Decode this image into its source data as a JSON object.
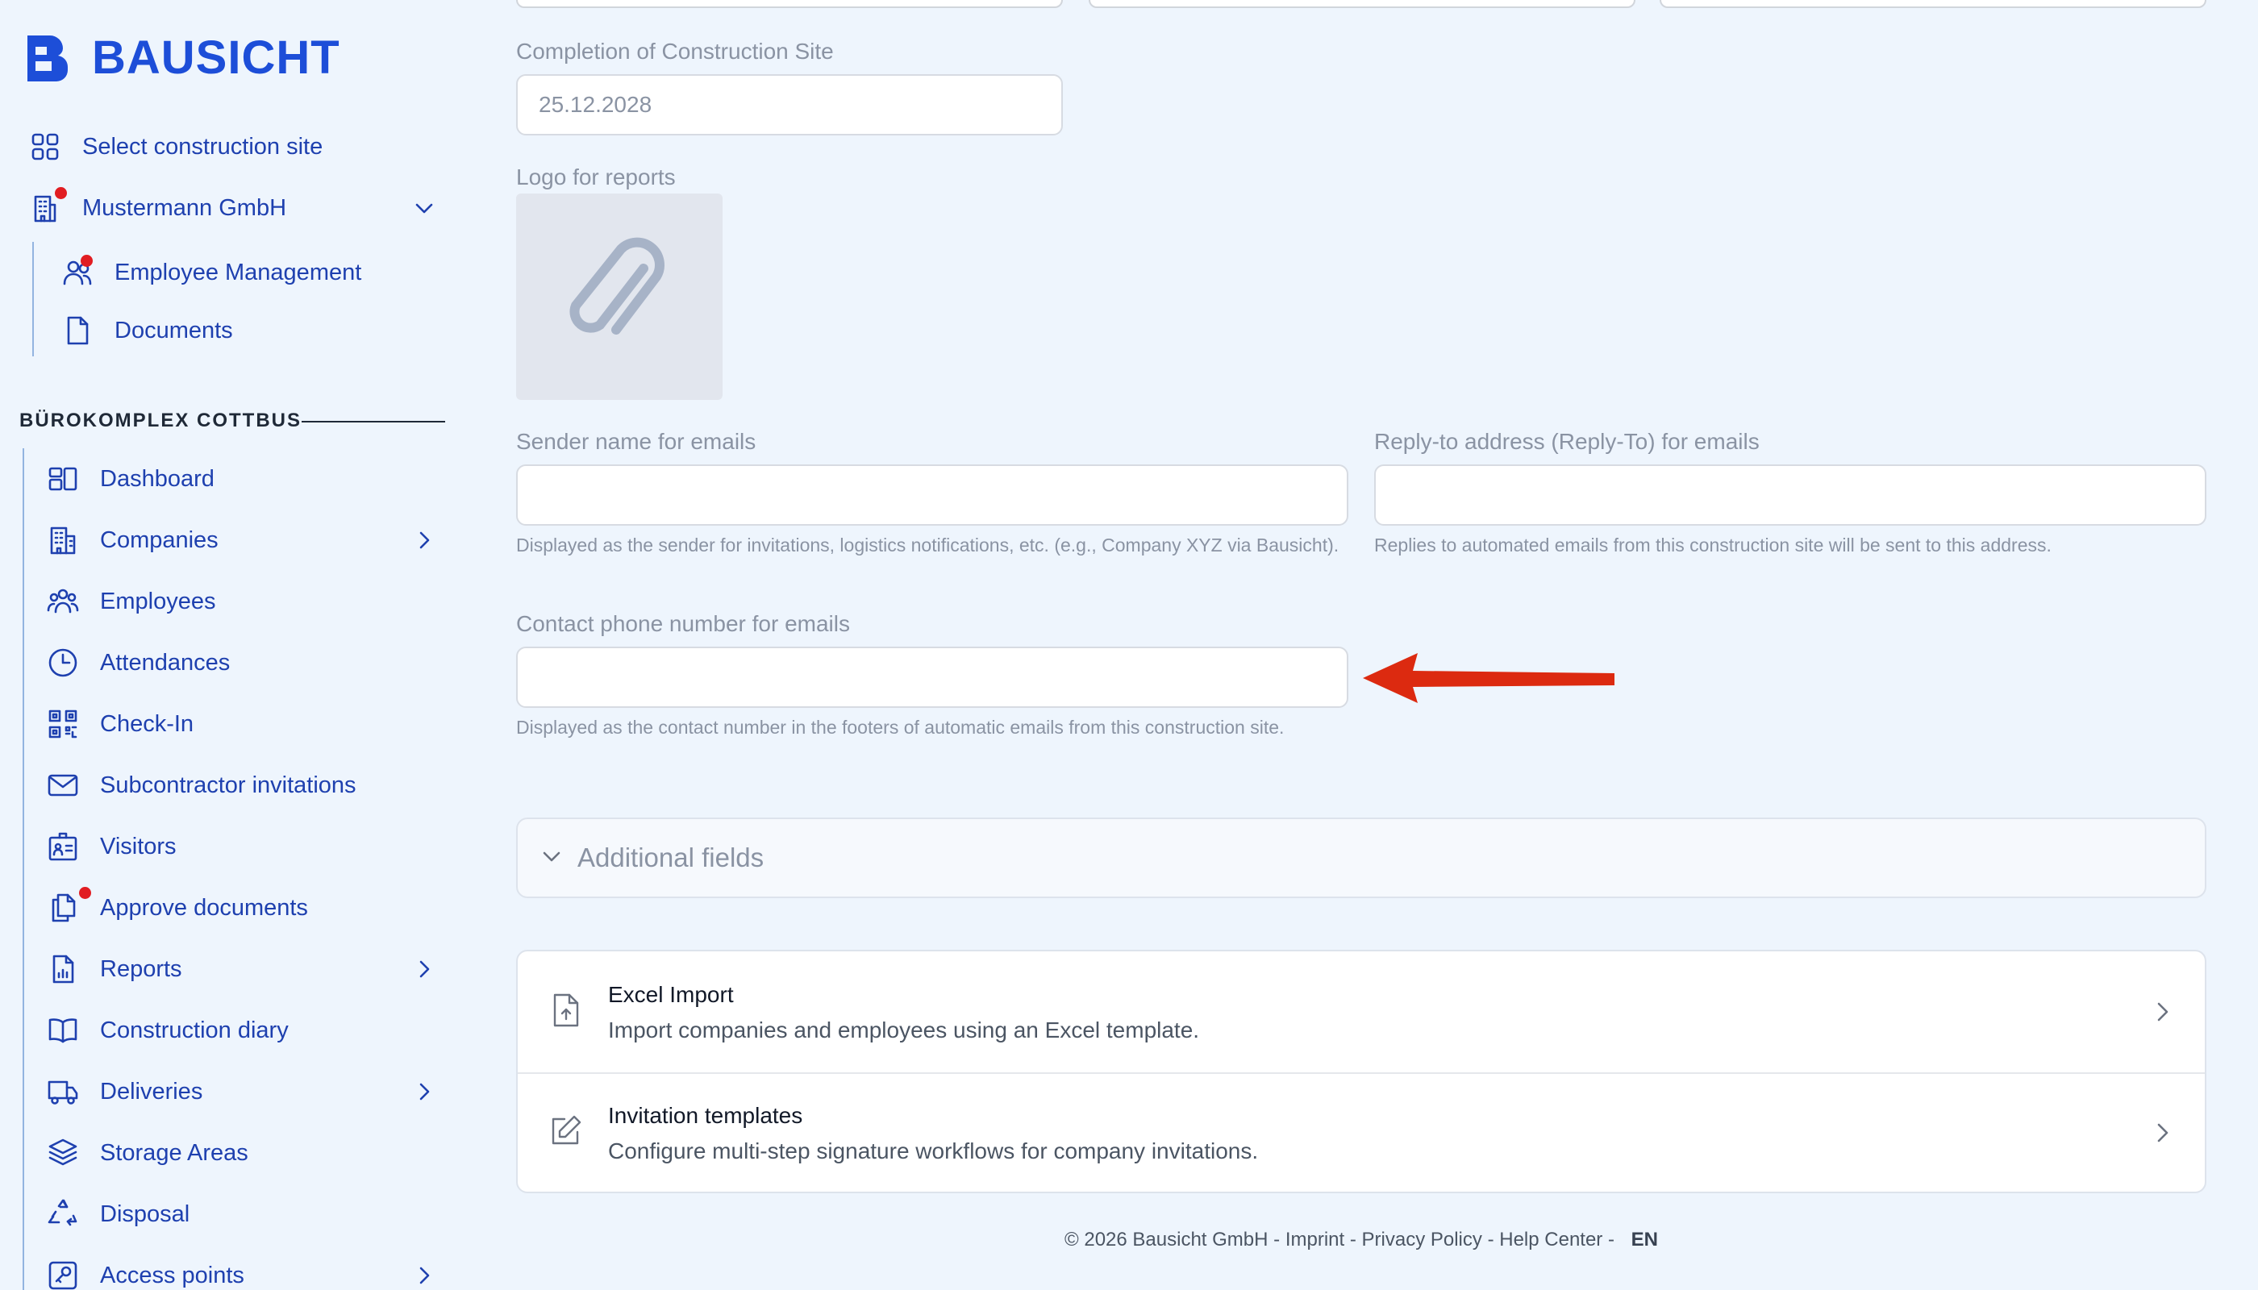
{
  "brand": {
    "name": "BAUSICHT"
  },
  "sidebar": {
    "top_items": [
      {
        "label": "Select construction site",
        "icon": "grid-icon"
      },
      {
        "label": "Mustermann GmbH",
        "icon": "building-icon"
      },
      {
        "label": "Employee Management",
        "icon": "users-icon"
      },
      {
        "label": "Documents",
        "icon": "document-icon"
      }
    ],
    "section_title": "BÜROKOMPLEX COTTBUS",
    "items": [
      {
        "label": "Dashboard",
        "icon": "dashboard-icon"
      },
      {
        "label": "Companies",
        "icon": "building-icon"
      },
      {
        "label": "Employees",
        "icon": "users-icon"
      },
      {
        "label": "Attendances",
        "icon": "clock-icon"
      },
      {
        "label": "Check-In",
        "icon": "qr-code-icon"
      },
      {
        "label": "Subcontractor invitations",
        "icon": "envelope-icon"
      },
      {
        "label": "Visitors",
        "icon": "id-card-icon"
      },
      {
        "label": "Approve documents",
        "icon": "documents-icon"
      },
      {
        "label": "Reports",
        "icon": "report-icon"
      },
      {
        "label": "Construction diary",
        "icon": "book-icon"
      },
      {
        "label": "Deliveries",
        "icon": "truck-icon"
      },
      {
        "label": "Storage Areas",
        "icon": "layers-icon"
      },
      {
        "label": "Disposal",
        "icon": "recycle-icon"
      },
      {
        "label": "Access points",
        "icon": "key-icon"
      }
    ]
  },
  "form": {
    "completion": {
      "label": "Completion of Construction Site",
      "value": "25.12.2028"
    },
    "logo": {
      "label": "Logo for reports"
    },
    "sender_name": {
      "label": "Sender name for emails",
      "value": "",
      "help": "Displayed as the sender for invitations, logistics notifications, etc. (e.g., Company XYZ via Bausicht)."
    },
    "reply_to": {
      "label": "Reply-to address (Reply-To) for emails",
      "value": "",
      "help": "Replies to automated emails from this construction site will be sent to this address."
    },
    "contact_phone": {
      "label": "Contact phone number for emails",
      "value": "",
      "help": "Displayed as the contact number in the footers of automatic emails from this construction site."
    },
    "additional_fields": {
      "label": "Additional fields"
    }
  },
  "cards": [
    {
      "title": "Excel Import",
      "subtitle": "Import companies and employees using an Excel template.",
      "icon": "file-upload-icon"
    },
    {
      "title": "Invitation templates",
      "subtitle": "Configure multi-step signature workflows for company invitations.",
      "icon": "edit-icon"
    }
  ],
  "footer": {
    "copyright": "© 2026 Bausicht GmbH",
    "links": [
      "Imprint",
      "Privacy Policy",
      "Help Center"
    ],
    "language": "EN"
  },
  "colors": {
    "accent": "#1e40af",
    "background": "#eef5fd",
    "notification_dot": "#e11d22",
    "annotation_arrow": "#dc2a10"
  }
}
